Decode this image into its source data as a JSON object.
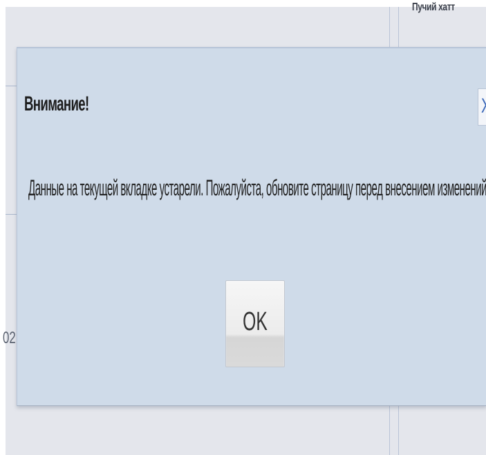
{
  "background": {
    "header_text": "Пучий хатт",
    "side_number": "02"
  },
  "dialog": {
    "title": "Внимание!",
    "close_label": "X",
    "message": "Данные на текущей вкладке устарели. Пожалуйста, обновите страницу перед внесением изменений.",
    "ok_label": "OK"
  }
}
